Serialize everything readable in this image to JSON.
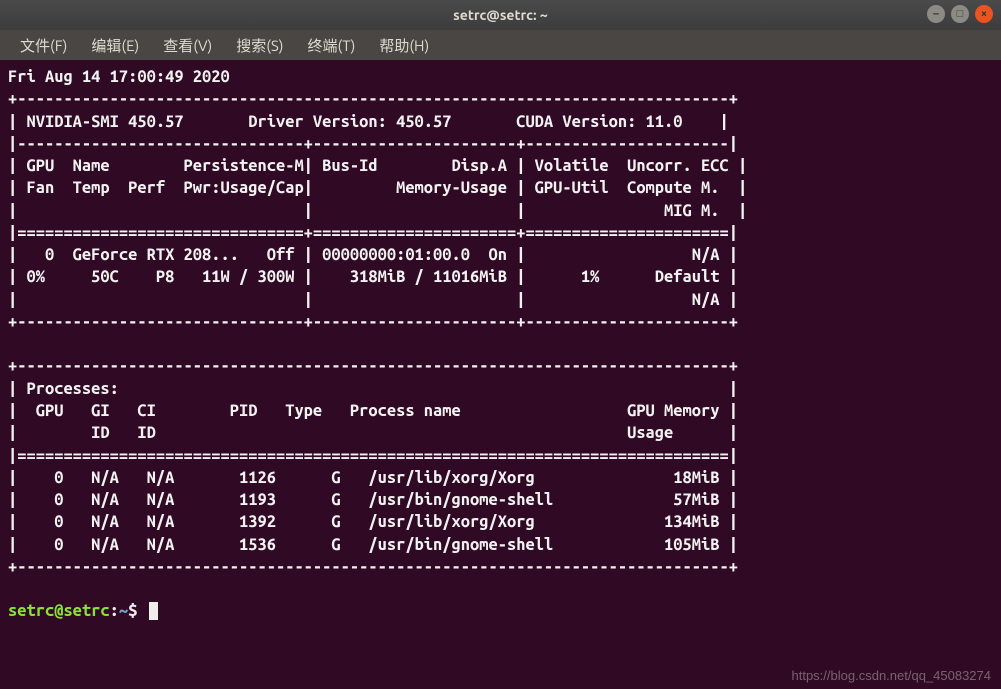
{
  "window": {
    "title": "setrc@setrc: ~"
  },
  "menubar": {
    "items": [
      "文件(F)",
      "编辑(E)",
      "查看(V)",
      "搜索(S)",
      "终端(T)",
      "帮助(H)"
    ]
  },
  "timestamp": "Fri Aug 14 17:00:49 2020",
  "smi_header": {
    "smi_version": "NVIDIA-SMI 450.57",
    "driver_label": "Driver Version:",
    "driver_version": "450.57",
    "cuda_label": "CUDA Version:",
    "cuda_version": "11.0"
  },
  "gpu_table": {
    "header_lines": [
      " GPU  Name        Persistence-M| Bus-Id        Disp.A | Volatile  Uncorr. ECC ",
      " Fan  Temp  Perf  Pwr:Usage/Cap|         Memory-Usage | GPU-Util  Compute M.  ",
      "                               |                      |               MIG M.  "
    ],
    "rows": [
      {
        "gpu_id": "0",
        "name": "GeForce RTX 208...",
        "persistence": "Off",
        "bus_id": "00000000:01:00.0",
        "disp_a": "On",
        "ecc": "N/A",
        "fan": "0%",
        "temp": "50C",
        "perf": "P8",
        "power": "11W / 300W",
        "memory": "318MiB / 11016MiB",
        "gpu_util": "1%",
        "compute_mode": "Default",
        "mig_mode": "N/A"
      }
    ]
  },
  "processes": {
    "title": "Processes:",
    "header_lines": [
      "  GPU   GI   CI        PID   Type   Process name                  GPU Memory ",
      "        ID   ID                                                   Usage      "
    ],
    "rows": [
      {
        "gpu": "0",
        "gi": "N/A",
        "ci": "N/A",
        "pid": "1126",
        "type": "G",
        "name": "/usr/lib/xorg/Xorg",
        "mem": "18MiB"
      },
      {
        "gpu": "0",
        "gi": "N/A",
        "ci": "N/A",
        "pid": "1193",
        "type": "G",
        "name": "/usr/bin/gnome-shell",
        "mem": "57MiB"
      },
      {
        "gpu": "0",
        "gi": "N/A",
        "ci": "N/A",
        "pid": "1392",
        "type": "G",
        "name": "/usr/lib/xorg/Xorg",
        "mem": "134MiB"
      },
      {
        "gpu": "0",
        "gi": "N/A",
        "ci": "N/A",
        "pid": "1536",
        "type": "G",
        "name": "/usr/bin/gnome-shell",
        "mem": "105MiB"
      }
    ]
  },
  "prompt": {
    "user_host": "setrc@setrc",
    "colon": ":",
    "path": "~",
    "dollar": "$"
  },
  "watermark": "https://blog.csdn.net/qq_45083274"
}
